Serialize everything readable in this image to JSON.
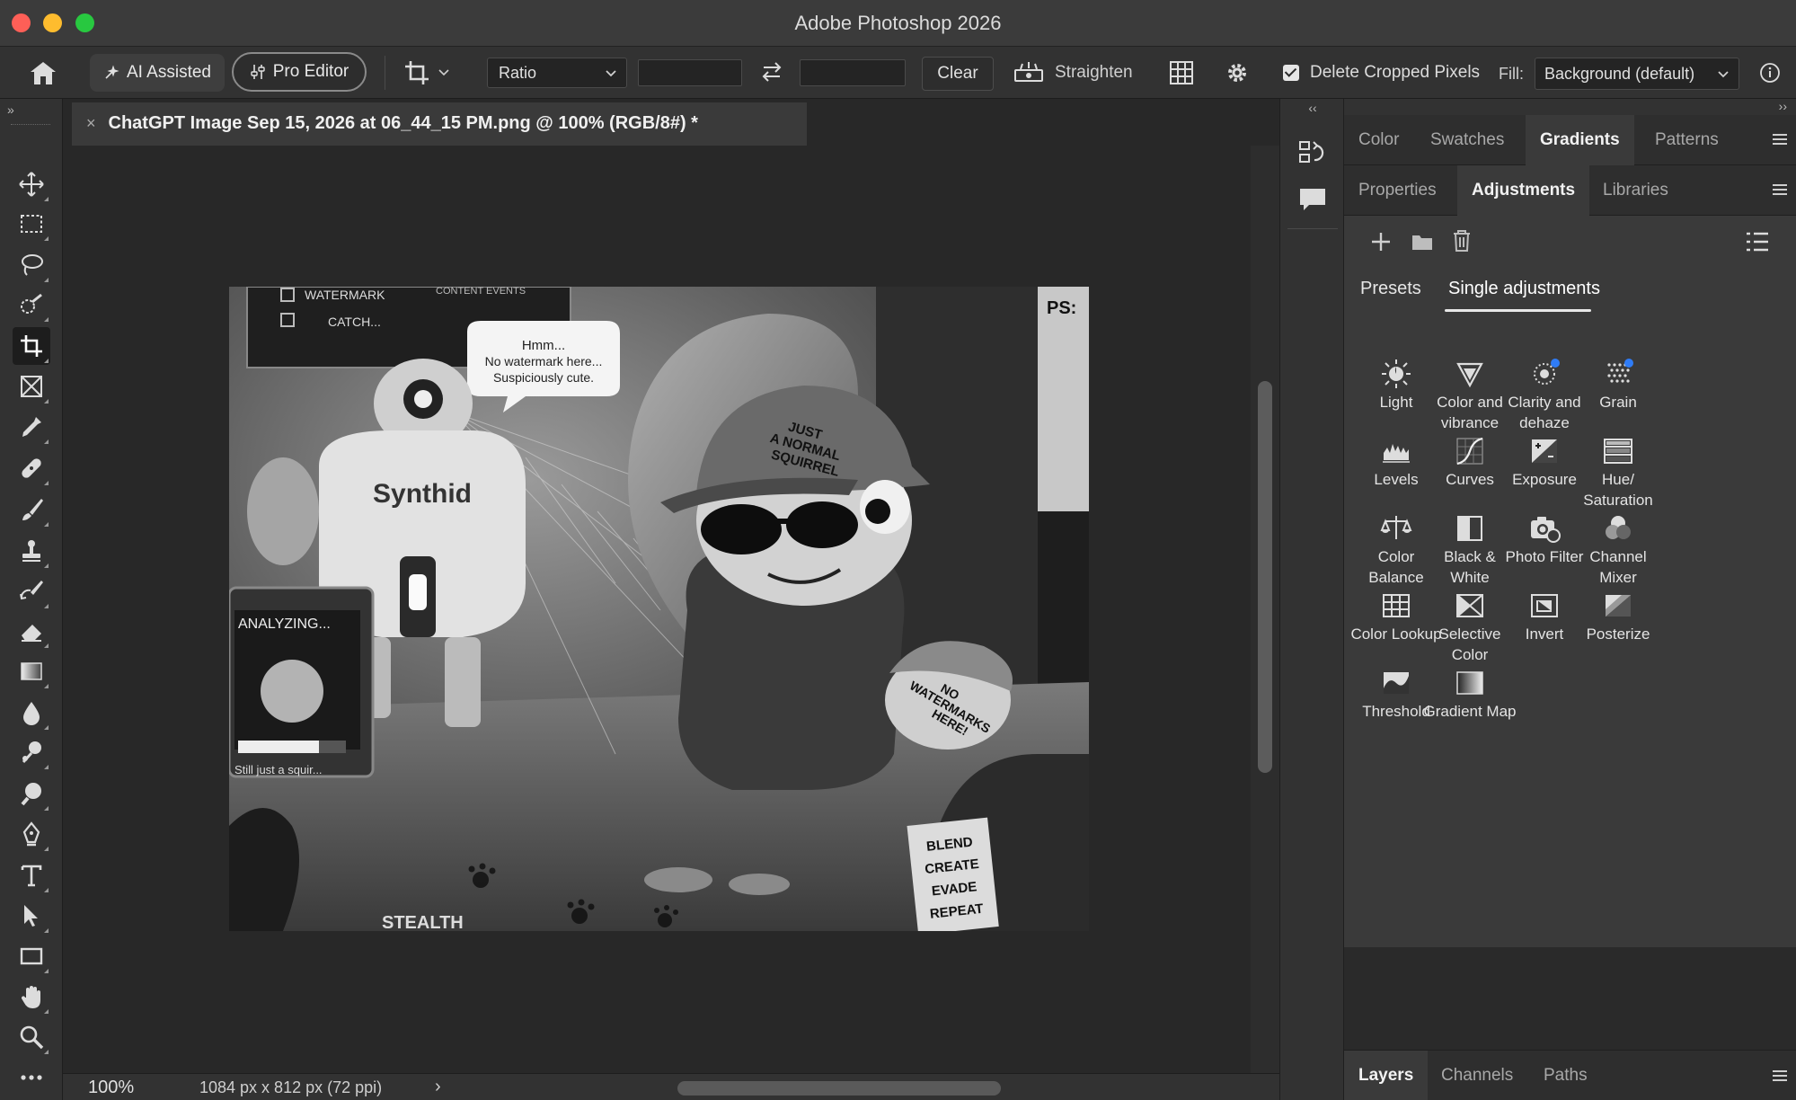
{
  "window": {
    "title": "Adobe Photoshop 2026"
  },
  "options_bar": {
    "ai_assisted_label": "AI Assisted",
    "pro_editor_label": "Pro Editor",
    "ratio_value": "Ratio",
    "ratio_width_value": "",
    "ratio_height_value": "",
    "clear_label": "Clear",
    "straighten_label": "Straighten",
    "delete_cropped_label": "Delete Cropped Pixels",
    "delete_cropped_checked": true,
    "fill_label": "Fill:",
    "fill_value": "Background (default)"
  },
  "toolbar": {
    "collapse_glyph": "»",
    "tools": [
      {
        "icon": "move-icon"
      },
      {
        "icon": "marquee-icon"
      },
      {
        "icon": "lasso-icon"
      },
      {
        "icon": "quick-selection-icon"
      },
      {
        "icon": "crop-icon",
        "active": true
      },
      {
        "icon": "frame-icon"
      },
      {
        "icon": "eyedropper-icon"
      },
      {
        "icon": "healing-brush-icon"
      },
      {
        "icon": "brush-icon"
      },
      {
        "icon": "clone-stamp-icon"
      },
      {
        "icon": "history-brush-icon"
      },
      {
        "icon": "eraser-icon"
      },
      {
        "icon": "gradient-icon"
      },
      {
        "icon": "blur-icon"
      },
      {
        "icon": "dodge-icon"
      },
      {
        "icon": "sponge-icon"
      },
      {
        "icon": "pen-icon"
      },
      {
        "icon": "type-icon"
      },
      {
        "icon": "path-selection-icon"
      },
      {
        "icon": "rectangle-icon"
      },
      {
        "icon": "hand-icon"
      },
      {
        "icon": "zoom-icon"
      },
      {
        "icon": "more-tools-icon"
      }
    ]
  },
  "document": {
    "tab_title": "ChatGPT Image Sep 15, 2026 at 06_44_15 PM.png @ 100% (RGB/8#) *",
    "close_glyph": "×",
    "image": {
      "robot_label": "Synthid",
      "bubble_text": "Hmm...\nNo watermark here...\nSuspiciously cute.",
      "cap_text": "JUST A NORMAL SQUIRREL",
      "acorn_text": "NO WATERMARKS HERE!",
      "monitor_title": "ANALYZING...",
      "monitor_footer": "Still just a squir...",
      "board_items": [
        "WATERMARK",
        "CATCH..."
      ],
      "board_header": "CONTENT EVENTS",
      "tag_text": "BLEND CREATE EVADE REPEAT",
      "floor_text": "STEALTH",
      "poster_text": "PS:"
    }
  },
  "status_bar": {
    "zoom": "100%",
    "doc_info": "1084 px x 812 px (72 ppi)",
    "arrow": "›"
  },
  "side_strip": {
    "collapse_glyph": "‹‹",
    "icons": [
      "history-icon",
      "comments-icon"
    ]
  },
  "right_panel": {
    "collapse_glyph": "››",
    "tabs_row1": [
      {
        "label": "Color",
        "active": false
      },
      {
        "label": "Swatches",
        "active": false
      },
      {
        "label": "Gradients",
        "active": true
      },
      {
        "label": "Patterns",
        "active": false
      }
    ],
    "tabs_row2": [
      {
        "label": "Properties",
        "active": false
      },
      {
        "label": "Adjustments",
        "active": true
      },
      {
        "label": "Libraries",
        "active": false
      }
    ],
    "adjustments": {
      "subtabs": [
        {
          "label": "Presets",
          "active": false
        },
        {
          "label": "Single adjustments",
          "active": true
        }
      ],
      "items": [
        {
          "label": "Light",
          "icon": "light-icon"
        },
        {
          "label": "Color and vibrance",
          "icon": "color-vibrance-icon"
        },
        {
          "label": "Clarity and dehaze",
          "icon": "clarity-dehaze-icon"
        },
        {
          "label": "Grain",
          "icon": "grain-icon"
        },
        {
          "label": "Levels",
          "icon": "levels-icon"
        },
        {
          "label": "Curves",
          "icon": "curves-icon"
        },
        {
          "label": "Exposure",
          "icon": "exposure-icon"
        },
        {
          "label": "Hue/ Saturation",
          "icon": "hue-saturation-icon"
        },
        {
          "label": "Color Balance",
          "icon": "color-balance-icon"
        },
        {
          "label": "Black & White",
          "icon": "black-white-icon"
        },
        {
          "label": "Photo Filter",
          "icon": "photo-filter-icon"
        },
        {
          "label": "Channel Mixer",
          "icon": "channel-mixer-icon"
        },
        {
          "label": "Color Lookup",
          "icon": "color-lookup-icon"
        },
        {
          "label": "Selective Color",
          "icon": "selective-color-icon"
        },
        {
          "label": "Invert",
          "icon": "invert-icon"
        },
        {
          "label": "Posterize",
          "icon": "posterize-icon"
        },
        {
          "label": "Threshold",
          "icon": "threshold-icon"
        },
        {
          "label": "Gradient Map",
          "icon": "gradient-map-icon"
        }
      ]
    },
    "layers_tabs": [
      {
        "label": "Layers",
        "active": true
      },
      {
        "label": "Channels",
        "active": false
      },
      {
        "label": "Paths",
        "active": false
      }
    ]
  },
  "colors": {
    "titlebar": "#3b3b3b",
    "panel": "#323232",
    "canvas_bg": "#282828",
    "accent_dot": "#2f7cf6"
  }
}
